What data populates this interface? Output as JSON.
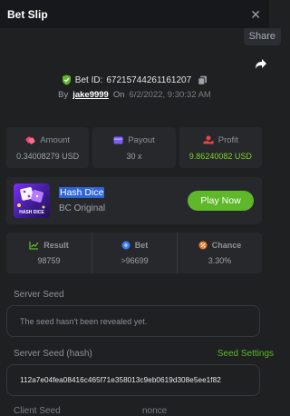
{
  "header": {
    "title": "Bet Slip",
    "close_icon": "close-icon"
  },
  "share": {
    "label": "Share"
  },
  "bet": {
    "id_label": "Bet ID:",
    "id_value": "6721574426116120​7",
    "by_label": "By",
    "user": "jake9999",
    "on_label": "On",
    "date": "6/2/2022, 9:30:32 AM"
  },
  "summary": {
    "amount": {
      "label": "Amount",
      "value": "0.34008279 USD"
    },
    "payout": {
      "label": "Payout",
      "value": "30 x"
    },
    "profit": {
      "label": "Profit",
      "value": "9.86240082 USD"
    }
  },
  "game": {
    "name": "Hash Dice",
    "provider": "BC Original",
    "thumb_caption": "HASH DICE",
    "play_label": "Play Now"
  },
  "result_stats": {
    "result": {
      "label": "Result",
      "value": "98759"
    },
    "bet": {
      "label": "Bet",
      "value": ">96699"
    },
    "chance": {
      "label": "Chance",
      "value": "3.30%"
    }
  },
  "server_seed": {
    "label": "Server Seed",
    "placeholder": "The seed hasn't been revealed yet."
  },
  "server_seed_hash": {
    "label": "Server Seed (hash)",
    "settings_label": "Seed Settings",
    "value": "112a7e04fea08416c465f71e358013c9eb0619d308e5ee1f82"
  },
  "client_seed": {
    "label": "Client Seed",
    "nonce_label": "nonce"
  },
  "colors": {
    "accent_green": "#5eb82a",
    "profit_green": "#7ed321",
    "highlight_blue": "#2f65d6"
  }
}
